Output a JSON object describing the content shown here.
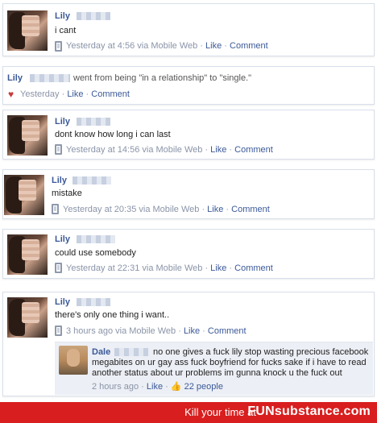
{
  "posts": [
    {
      "name": "Lily",
      "text": "i cant",
      "meta_time": "Yesterday at 4:56 via Mobile Web",
      "like": "Like",
      "comment": "Comment"
    },
    {
      "name": "Lily",
      "text": "dont know how long i can last",
      "meta_time": "Yesterday at 14:56 via Mobile Web",
      "like": "Like",
      "comment": "Comment"
    },
    {
      "name": "Lily",
      "text": "mistake",
      "meta_time": "Yesterday at 20:35 via Mobile Web",
      "like": "Like",
      "comment": "Comment"
    },
    {
      "name": "Lily",
      "text": "could use somebody",
      "meta_time": "Yesterday at 22:31 via Mobile Web",
      "like": "Like",
      "comment": "Comment"
    },
    {
      "name": "Lily",
      "text": "there's only one thing i want..",
      "meta_time": "3 hours ago via Mobile Web",
      "like": "Like",
      "comment": "Comment"
    }
  ],
  "relationship": {
    "name": "Lily",
    "text_before": "went from being \"in a relationship\" to \"single.\"",
    "meta_time": "Yesterday",
    "like": "Like",
    "comment": "Comment"
  },
  "reply": {
    "name": "Dale",
    "text": "no one gives a fuck lily stop wasting precious facebook megabites on ur gay ass fuck boyfriend for fucks sake if i have to read another status about ur problems im gunna knock u the fuck out",
    "meta_time": "2 hours ago",
    "like": "Like",
    "likes_count": "22 people"
  },
  "banner": {
    "tagline": "Kill your time at",
    "brand": "FUNsubstance.com"
  },
  "colors": {
    "link_blue": "#3b5998",
    "meta_gray": "#8a94a8",
    "banner_red": "#d81e1e"
  }
}
